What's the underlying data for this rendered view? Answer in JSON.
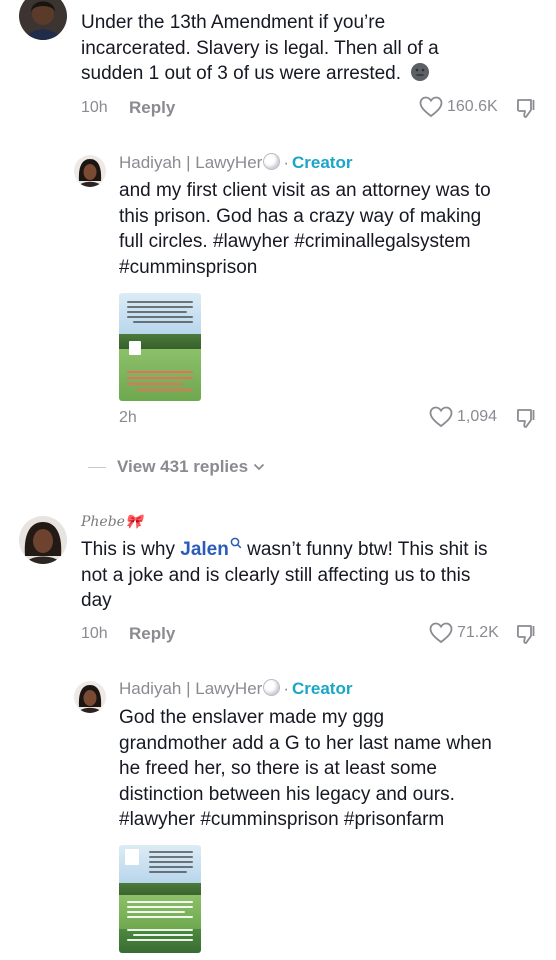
{
  "comment1": {
    "text_lines": [
      "Under the 13th Amendment if you’re",
      "incarcerated. Slavery is legal. Then all of a",
      "sudden 1 out of 3 of us were arrested."
    ],
    "time": "10h",
    "reply_label": "Reply",
    "likes": "160.6K"
  },
  "reply1": {
    "author": "Hadiyah | LawyHer",
    "separator": "·",
    "badge": "Creator",
    "text_lines": [
      "and my first client visit as an attorney was to",
      "this prison. God has a crazy way of making",
      "full circles.  #lawyher #criminallegalsystem",
      "#cumminsprison"
    ],
    "time": "2h",
    "likes": "1,094"
  },
  "view_replies": {
    "label": "View 431 replies"
  },
  "comment2": {
    "author": "Phebe🎀",
    "text_before_mention": "This is why ",
    "mention": "Jalen",
    "text_after_mention": " wasn’t funny btw! This shit is",
    "text_lines": [
      "not a joke and is clearly still affecting us to this",
      "day"
    ],
    "time": "10h",
    "reply_label": "Reply",
    "likes": "71.2K"
  },
  "reply2": {
    "author": "Hadiyah | LawyHer",
    "separator": "·",
    "badge": "Creator",
    "text_lines": [
      "God the enslaver made  my ggg",
      "grandmother add a G to her last name when",
      "he freed her, so there is at least some",
      "distinction between his legacy and ours.",
      "#lawyher #cumminsprison #prisonfarm"
    ]
  },
  "colors": {
    "text": "#161823",
    "muted": "#8a8b91",
    "creator": "#1ba6c7",
    "mention": "#2b5db8"
  },
  "icons": [
    "heart-outline-icon",
    "dislike-icon",
    "chevron-down-icon",
    "search-icon",
    "moon-emoji-icon"
  ]
}
